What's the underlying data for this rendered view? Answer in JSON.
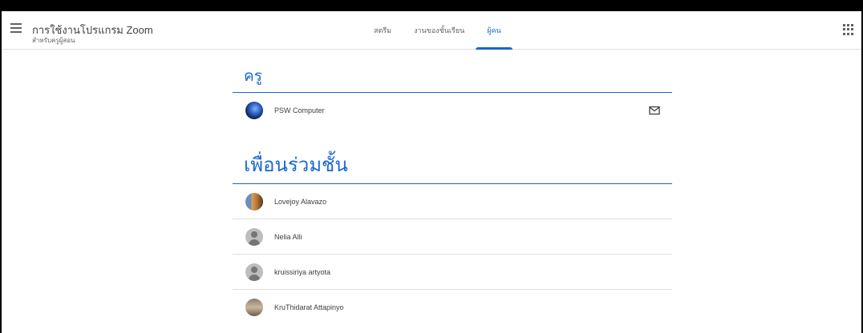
{
  "header": {
    "class_title": "การใช้งานโปรแกรม Zoom",
    "class_subtitle": "สำหรับครูผู้สอน",
    "tabs": [
      {
        "label": "สตรีม",
        "active": false
      },
      {
        "label": "งานของชั้นเรียน",
        "active": false
      },
      {
        "label": "ผู้คน",
        "active": true
      }
    ],
    "icons": {
      "menu": "menu-icon",
      "apps": "apps-grid-icon"
    }
  },
  "teachers": {
    "heading": "ครู",
    "people": [
      {
        "name": "PSW Computer",
        "avatar": "blue-sphere",
        "email_icon": "email-icon"
      }
    ]
  },
  "classmates": {
    "heading": "เพื่อนร่วมชั้น",
    "people": [
      {
        "name": "Lovejoy Alavazo",
        "avatar": "photo"
      },
      {
        "name": "Nelia Alli",
        "avatar": "default"
      },
      {
        "name": "kruissiriya artyota",
        "avatar": "default"
      },
      {
        "name": "KruThidarat Attapinyo",
        "avatar": "group-photo"
      }
    ]
  },
  "colors": {
    "accent": "#1967d2",
    "text": "#3c4043",
    "muted": "#5f6368",
    "divider": "#e0e0e0"
  }
}
